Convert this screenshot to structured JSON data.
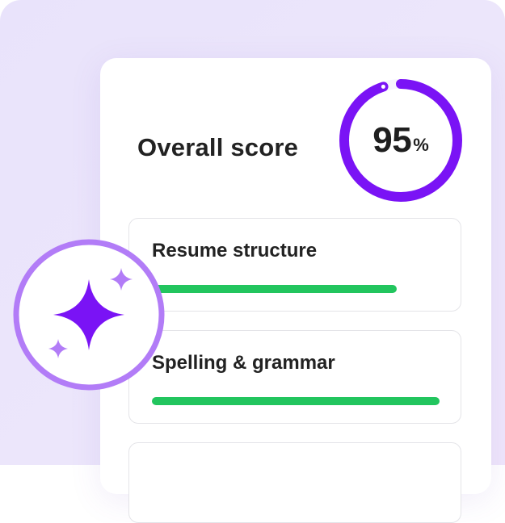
{
  "score_card": {
    "title": "Overall score",
    "score_value": "95",
    "score_unit": "%",
    "score_fraction": 0.95
  },
  "sections": [
    {
      "label": "Resume structure",
      "progress": 0.85
    },
    {
      "label": "Spelling & grammar",
      "progress": 1.0
    },
    {
      "label": "",
      "progress": 0
    }
  ],
  "colors": {
    "accent": "#7a13f5",
    "progress": "#22c55e",
    "badge_ring": "#b27cf7",
    "background": "#ece6fb"
  },
  "icons": {
    "badge": "sparkle-icon"
  }
}
